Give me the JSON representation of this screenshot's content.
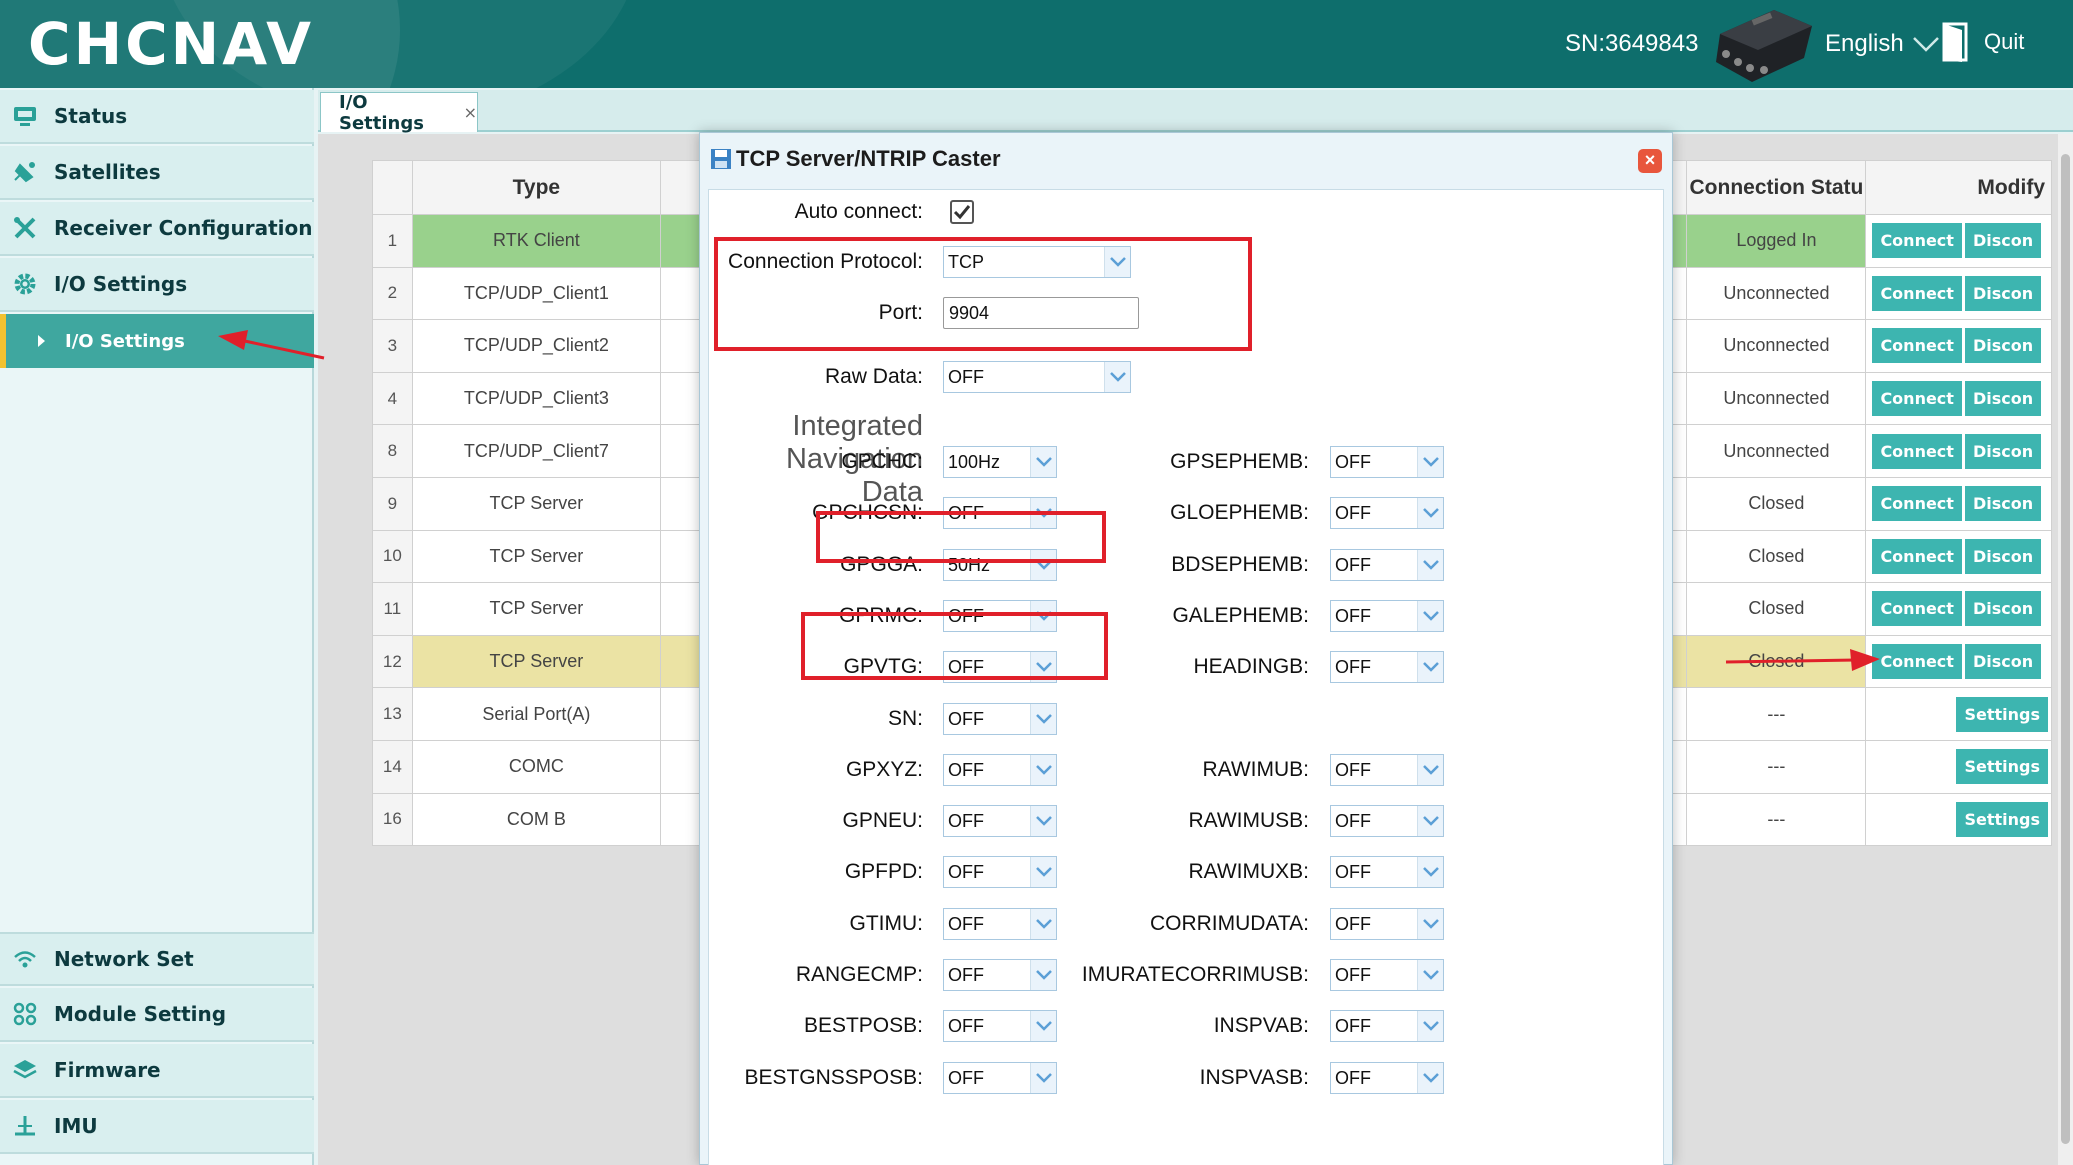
{
  "header": {
    "logo": "CHCNAV",
    "serial": "SN:3649843",
    "language": "English",
    "quit_label": "Quit"
  },
  "sidebar": {
    "items": [
      {
        "label": "Status",
        "icon": "monitor-icon"
      },
      {
        "label": "Satellites",
        "icon": "satellite-icon"
      },
      {
        "label": "Receiver Configuration",
        "icon": "tools-icon"
      },
      {
        "label": "I/O Settings",
        "icon": "gear-icon"
      },
      {
        "label": "I/O Settings",
        "icon": "triangle-right-icon",
        "selected": true
      },
      {
        "label": "Network Set",
        "icon": "wifi-icon"
      },
      {
        "label": "Module Setting",
        "icon": "modules-icon"
      },
      {
        "label": "Firmware",
        "icon": "layers-icon"
      },
      {
        "label": "IMU",
        "icon": "antenna-icon"
      }
    ]
  },
  "tabs": [
    {
      "label": "I/O Settings",
      "close": "×"
    }
  ],
  "table": {
    "headers": {
      "type": "Type",
      "status": "Connection Statu",
      "modify": "Modify"
    },
    "rows": [
      {
        "num": "1",
        "type": "RTK Client",
        "status": "Logged In",
        "actions": [
          "Connect",
          "Discon"
        ],
        "highlight": "green"
      },
      {
        "num": "2",
        "type": "TCP/UDP_Client1",
        "status": "Unconnected",
        "actions": [
          "Connect",
          "Discon"
        ]
      },
      {
        "num": "3",
        "type": "TCP/UDP_Client2",
        "status": "Unconnected",
        "actions": [
          "Connect",
          "Discon"
        ]
      },
      {
        "num": "4",
        "type": "TCP/UDP_Client3",
        "status": "Unconnected",
        "actions": [
          "Connect",
          "Discon"
        ]
      },
      {
        "num": "8",
        "type": "TCP/UDP_Client7",
        "status": "Unconnected",
        "actions": [
          "Connect",
          "Discon"
        ]
      },
      {
        "num": "9",
        "type": "TCP Server",
        "status": "Closed",
        "actions": [
          "Connect",
          "Discon"
        ]
      },
      {
        "num": "10",
        "type": "TCP Server",
        "status": "Closed",
        "actions": [
          "Connect",
          "Discon"
        ]
      },
      {
        "num": "11",
        "type": "TCP Server",
        "status": "Closed",
        "actions": [
          "Connect",
          "Discon"
        ]
      },
      {
        "num": "12",
        "type": "TCP Server",
        "status": "Closed",
        "actions": [
          "Connect",
          "Discon"
        ],
        "highlight": "yellow"
      },
      {
        "num": "13",
        "type": "Serial Port(A)",
        "status": "---",
        "actions": [
          "Settings"
        ]
      },
      {
        "num": "14",
        "type": "COMC",
        "status": "---",
        "actions": [
          "Settings"
        ]
      },
      {
        "num": "16",
        "type": "COM B",
        "status": "---",
        "actions": [
          "Settings"
        ]
      }
    ]
  },
  "modal": {
    "title": "TCP Server/NTRIP Caster",
    "close": "×",
    "auto_connect_label": "Auto connect:",
    "auto_connect_checked": true,
    "protocol_label": "Connection Protocol:",
    "protocol_value": "TCP",
    "port_label": "Port:",
    "port_value": "9904",
    "raw_data_label": "Raw Data:",
    "raw_data_value": "OFF",
    "section_lines": [
      "Integrated",
      "Navigation",
      "Data"
    ],
    "left_fields": [
      {
        "label": "GPCHC:",
        "value": "100Hz"
      },
      {
        "label": "GPCHCSN:",
        "value": "OFF"
      },
      {
        "label": "GPGGA:",
        "value": "50Hz"
      },
      {
        "label": "GPRMC:",
        "value": "OFF"
      },
      {
        "label": "GPVTG:",
        "value": "OFF"
      },
      {
        "label": "SN:",
        "value": "OFF"
      },
      {
        "label": "GPXYZ:",
        "value": "OFF"
      },
      {
        "label": "GPNEU:",
        "value": "OFF"
      },
      {
        "label": "GPFPD:",
        "value": "OFF"
      },
      {
        "label": "GTIMU:",
        "value": "OFF"
      },
      {
        "label": "RANGECMP:",
        "value": "OFF"
      },
      {
        "label": "BESTPOSB:",
        "value": "OFF"
      },
      {
        "label": "BESTGNSSPOSB:",
        "value": "OFF"
      }
    ],
    "right_fields": [
      {
        "label": "GPSEPHEMB:",
        "value": "OFF"
      },
      {
        "label": "GLOEPHEMB:",
        "value": "OFF"
      },
      {
        "label": "BDSEPHEMB:",
        "value": "OFF"
      },
      {
        "label": "GALEPHEMB:",
        "value": "OFF"
      },
      {
        "label": "HEADINGB:",
        "value": "OFF"
      },
      {
        "label": "RAWIMUB:",
        "value": "OFF"
      },
      {
        "label": "RAWIMUSB:",
        "value": "OFF"
      },
      {
        "label": "RAWIMUXB:",
        "value": "OFF"
      },
      {
        "label": "CORRIMUDATA:",
        "value": "OFF"
      },
      {
        "label": "IMURATECORRIMUSB:",
        "value": "OFF"
      },
      {
        "label": "INSPVAB:",
        "value": "OFF"
      },
      {
        "label": "INSPVASB:",
        "value": "OFF"
      }
    ]
  },
  "colors": {
    "header": "#0e6e6c",
    "accent": "#3db5b0",
    "annotation": "#e0202a"
  }
}
